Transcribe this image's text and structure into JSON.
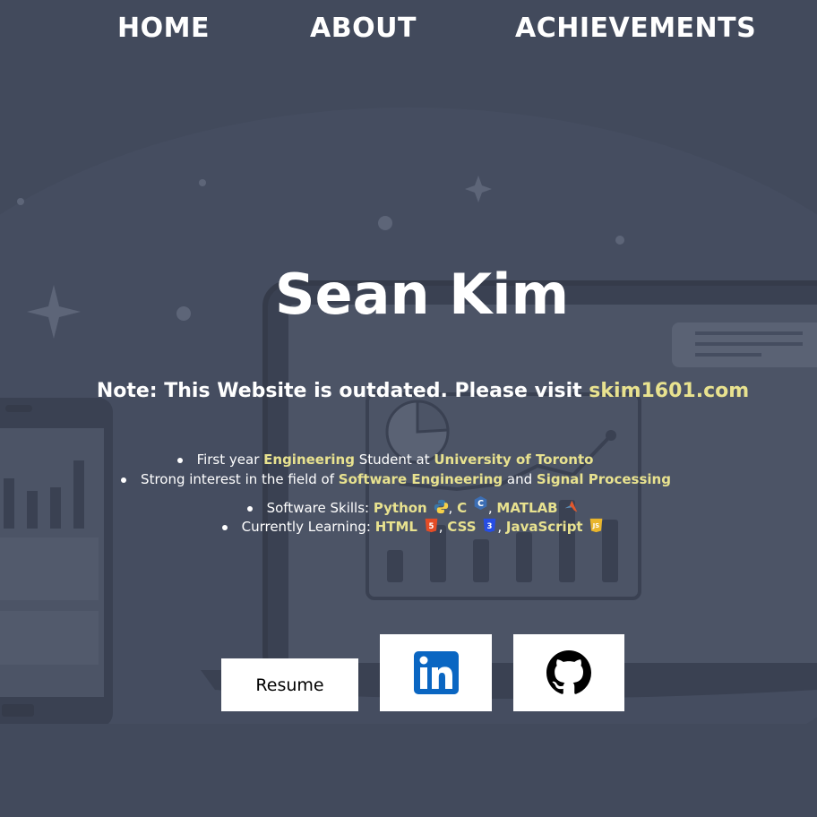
{
  "nav": {
    "home": "HOME",
    "about": "ABOUT",
    "achievements": "ACHIEVEMENTS"
  },
  "hero": {
    "name": "Sean Kim",
    "note_prefix": "Note: This Website is outdated. Please visit ",
    "note_link": "skim1601.com"
  },
  "bullets": {
    "b1": {
      "t1": "First year ",
      "h1": "Engineering",
      "t2": " Student at ",
      "h2": "University of Toronto"
    },
    "b2": {
      "t1": "Strong interest in the field of ",
      "h1": "Software Engineering",
      "t2": " and ",
      "h2": "Signal Processing"
    },
    "b3": {
      "t1": "Software Skills: ",
      "h1": "Python",
      "s1": ", ",
      "h2": "C",
      "s2": ", ",
      "h3": "MATLAB"
    },
    "b4": {
      "t1": "Currently Learning: ",
      "h1": "HTML",
      "s1": ", ",
      "h2": "CSS",
      "s2": ", ",
      "h3": "JavaScript"
    }
  },
  "buttons": {
    "resume": "Resume",
    "linkedin_icon": "linkedin-icon",
    "github_icon": "github-icon"
  },
  "colors": {
    "background": "#424a5c",
    "highlight": "#e8e28f",
    "linkedin": "#0a66c2"
  }
}
